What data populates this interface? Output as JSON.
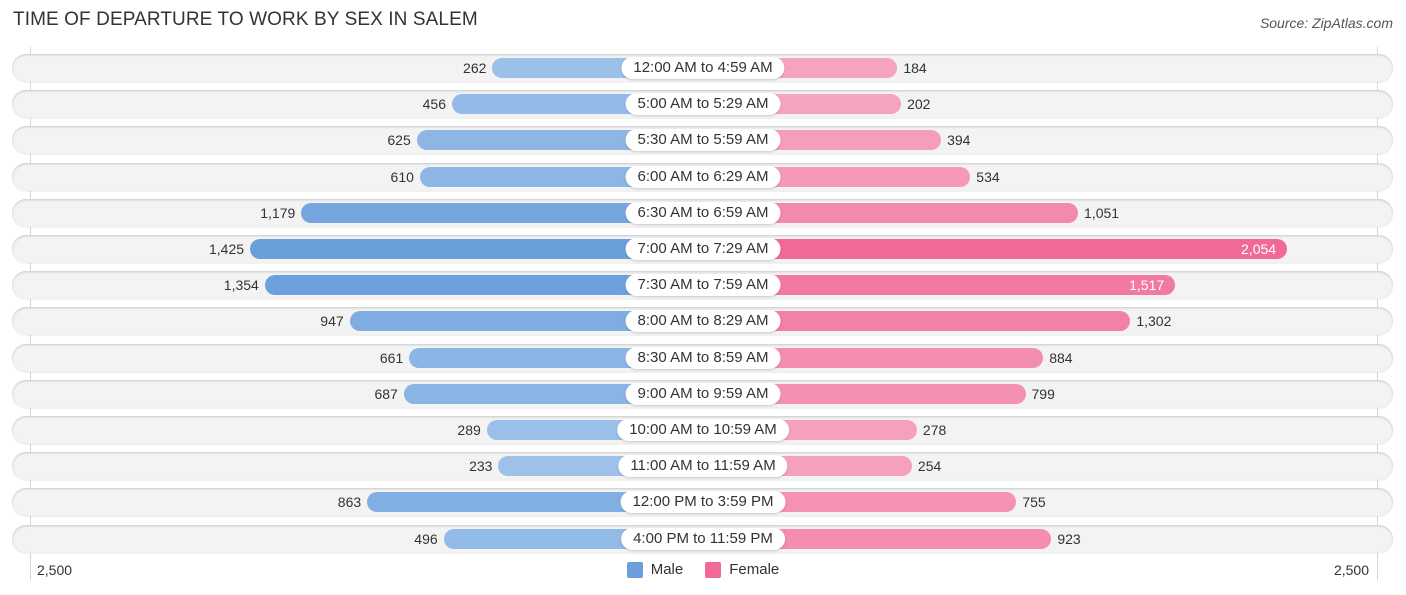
{
  "header": {
    "title": "TIME OF DEPARTURE TO WORK BY SEX IN SALEM",
    "source": "Source: ZipAtlas.com"
  },
  "colors": {
    "male": "#6a9fdc",
    "male_light": "#a8c8ec",
    "female": "#f06a95",
    "female_light": "#f7a9c2"
  },
  "chart_data": {
    "type": "bar",
    "orientation": "horizontal-diverging",
    "title": "TIME OF DEPARTURE TO WORK BY SEX IN SALEM",
    "categories": [
      "12:00 AM to 4:59 AM",
      "5:00 AM to 5:29 AM",
      "5:30 AM to 5:59 AM",
      "6:00 AM to 6:29 AM",
      "6:30 AM to 6:59 AM",
      "7:00 AM to 7:29 AM",
      "7:30 AM to 7:59 AM",
      "8:00 AM to 8:29 AM",
      "8:30 AM to 8:59 AM",
      "9:00 AM to 9:59 AM",
      "10:00 AM to 10:59 AM",
      "11:00 AM to 11:59 AM",
      "12:00 PM to 3:59 PM",
      "4:00 PM to 11:59 PM"
    ],
    "series": [
      {
        "name": "Male",
        "values": [
          262,
          456,
          625,
          610,
          1179,
          1425,
          1354,
          947,
          661,
          687,
          289,
          233,
          863,
          496
        ],
        "labels": [
          "262",
          "456",
          "625",
          "610",
          "1,179",
          "1,425",
          "1,354",
          "947",
          "661",
          "687",
          "289",
          "233",
          "863",
          "496"
        ]
      },
      {
        "name": "Female",
        "values": [
          184,
          202,
          394,
          534,
          1051,
          2054,
          1517,
          1302,
          884,
          799,
          278,
          254,
          755,
          923
        ],
        "labels": [
          "184",
          "202",
          "394",
          "534",
          "1,051",
          "2,054",
          "1,517",
          "1,302",
          "884",
          "799",
          "278",
          "254",
          "755",
          "923"
        ]
      }
    ],
    "xlim": [
      -2500,
      2500
    ],
    "tick_labels": {
      "left": "2,500",
      "right": "2,500"
    },
    "legend": {
      "position": "bottom-center",
      "entries": [
        "Male",
        "Female"
      ]
    },
    "grid": false
  }
}
